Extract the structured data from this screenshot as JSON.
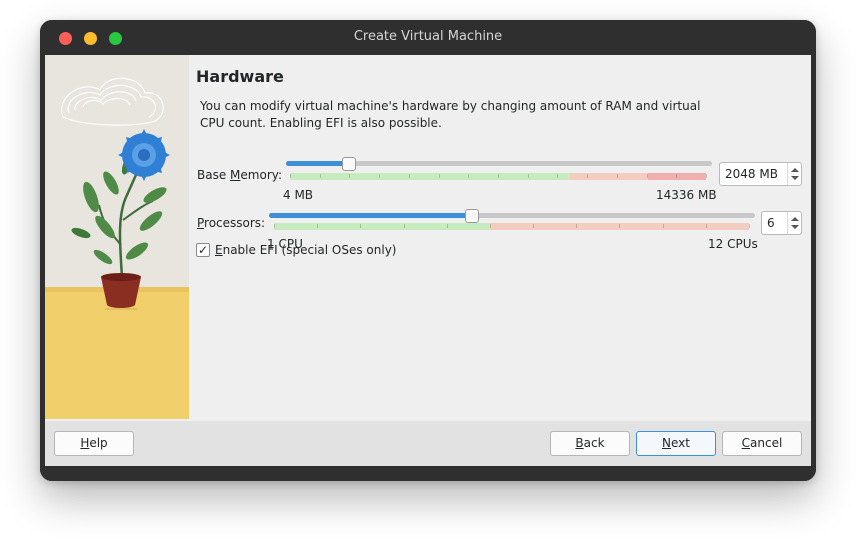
{
  "window": {
    "title": "Create Virtual Machine"
  },
  "page": {
    "heading": "Hardware",
    "description": "You can modify virtual machine's hardware by changing amount of RAM and virtual CPU count. Enabling EFI is also possible."
  },
  "memory": {
    "label_prefix": "Base ",
    "label_mnemonic": "M",
    "label_suffix": "emory:",
    "value": "2048 MB",
    "min_label": "4 MB",
    "max_label": "14336 MB",
    "min_mb": 4,
    "max_mb": 14336,
    "current_mb": 2048
  },
  "processors": {
    "label_mnemonic": "P",
    "label_suffix": "rocessors:",
    "value": "6",
    "min_label": "1 CPU",
    "max_label": "12 CPUs",
    "min": 1,
    "max": 12,
    "current": 6
  },
  "efi": {
    "checked": true,
    "check_mark": "✓",
    "label_mnemonic": "E",
    "label_suffix": "nable EFI (special OSes only)"
  },
  "buttons": {
    "help_mnemonic": "H",
    "help_rest": "elp",
    "back_mnemonic": "B",
    "back_rest": "ack",
    "next_mnemonic": "N",
    "next_rest": "ext",
    "cancel_mnemonic": "C",
    "cancel_rest": "ancel"
  },
  "colors": {
    "accent": "#3d8fd8",
    "ok_zone": "#bfe9b8",
    "warn_zone": "#f3c6b6",
    "danger_zone": "#f0a8a8",
    "titlebar": "#2f2f2f"
  }
}
